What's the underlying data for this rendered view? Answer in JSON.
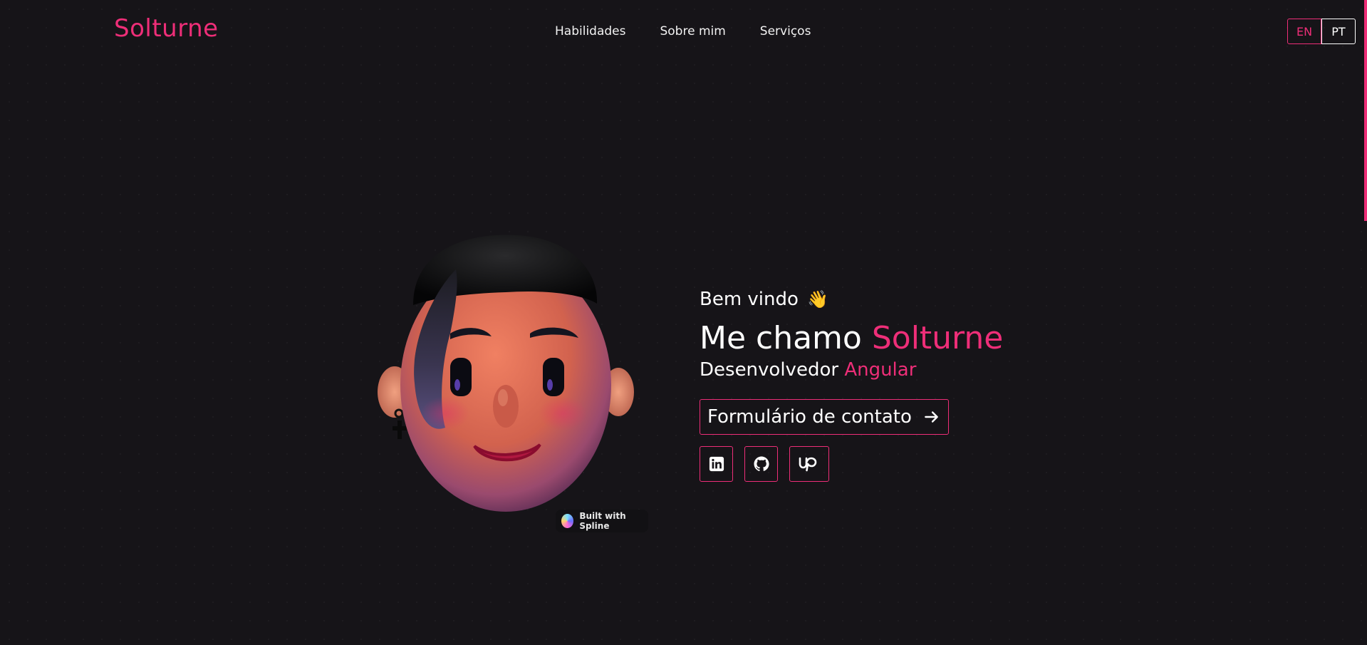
{
  "brand": {
    "logo": "Solturne",
    "accent_color": "#ee2e78"
  },
  "nav": {
    "items": [
      "Habilidades",
      "Sobre mim",
      "Serviços"
    ]
  },
  "lang": {
    "en": "EN",
    "pt": "PT",
    "active": "EN"
  },
  "hero": {
    "welcome": "Bem vindo",
    "wave_icon": "waving-hand-icon",
    "name_prefix": "Me chamo",
    "name_accent": "Solturne",
    "role_prefix": "Desenvolvedor",
    "role_accent": "Angular",
    "contact_label": "Formulário de contato"
  },
  "socials": [
    {
      "icon": "linkedin-icon"
    },
    {
      "icon": "github-icon"
    },
    {
      "icon": "upwork-icon"
    }
  ],
  "spline": {
    "badge": "Built with Spline"
  }
}
